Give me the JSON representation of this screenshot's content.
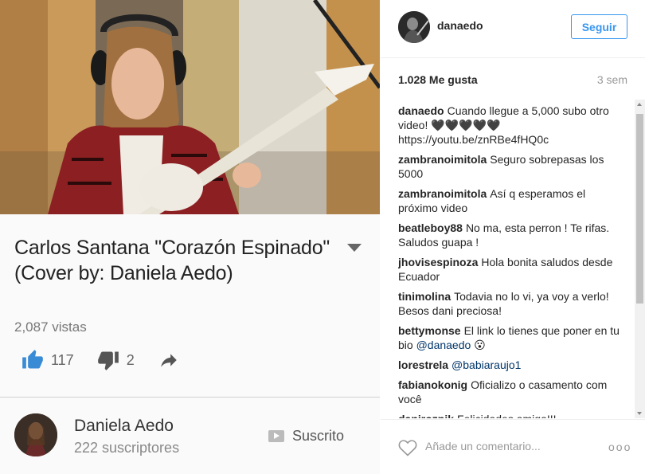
{
  "video": {
    "title": "Carlos Santana \"Corazón Espinado\" (Cover by: Daniela Aedo)",
    "views": "2,087 vistas",
    "likes": "117",
    "dislikes": "2"
  },
  "channel": {
    "name": "Daniela Aedo",
    "subscribers": "222 suscriptores",
    "subscribe_status": "Suscrito"
  },
  "instagram": {
    "username": "danaedo",
    "follow_label": "Seguir",
    "likes": "1.028 Me gusta",
    "time_ago": "3 sem",
    "comments": [
      {
        "user": "danaedo",
        "text": "Cuando llegue a 5,000 subo otro video! 🖤🖤🖤🖤🖤 https://youtu.be/znRBe4fHQ0c"
      },
      {
        "user": "zambranoimitola",
        "text": "Seguro sobrepasas los 5000"
      },
      {
        "user": "zambranoimitola",
        "text": "Así q esperamos el próximo video"
      },
      {
        "user": "beatleboy88",
        "text": "No ma, esta perron ! Te rifas. Saludos guapa !"
      },
      {
        "user": "jhovisespinoza",
        "text": "Hola bonita saludos desde Ecuador"
      },
      {
        "user": "tinimolina",
        "text": "Todavia no lo vi, ya voy a verlo! Besos dani preciosa!"
      },
      {
        "user": "bettymonse",
        "text": "El link lo tienes que poner en tu bio",
        "mention": "@danaedo",
        "after": " 😮"
      },
      {
        "user": "lorestrela",
        "text": "",
        "mention": "@babiaraujo1",
        "after": ""
      },
      {
        "user": "fabianokonig",
        "text": "Oficializo o casamento com você"
      },
      {
        "user": "danirozpik",
        "text": "Felicidades amiga!!!"
      }
    ],
    "comment_placeholder": "Añade un comentario...",
    "more_label": "ooo"
  }
}
